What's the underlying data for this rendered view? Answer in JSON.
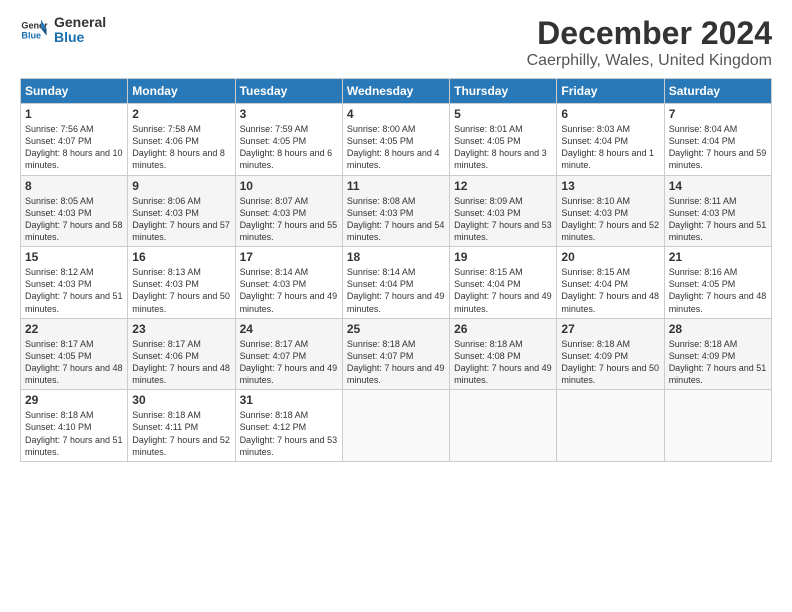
{
  "logo": {
    "line1": "General",
    "line2": "Blue"
  },
  "title": "December 2024",
  "subtitle": "Caerphilly, Wales, United Kingdom",
  "days_header": [
    "Sunday",
    "Monday",
    "Tuesday",
    "Wednesday",
    "Thursday",
    "Friday",
    "Saturday"
  ],
  "weeks": [
    [
      {
        "num": "1",
        "sunrise": "Sunrise: 7:56 AM",
        "sunset": "Sunset: 4:07 PM",
        "daylight": "Daylight: 8 hours and 10 minutes."
      },
      {
        "num": "2",
        "sunrise": "Sunrise: 7:58 AM",
        "sunset": "Sunset: 4:06 PM",
        "daylight": "Daylight: 8 hours and 8 minutes."
      },
      {
        "num": "3",
        "sunrise": "Sunrise: 7:59 AM",
        "sunset": "Sunset: 4:05 PM",
        "daylight": "Daylight: 8 hours and 6 minutes."
      },
      {
        "num": "4",
        "sunrise": "Sunrise: 8:00 AM",
        "sunset": "Sunset: 4:05 PM",
        "daylight": "Daylight: 8 hours and 4 minutes."
      },
      {
        "num": "5",
        "sunrise": "Sunrise: 8:01 AM",
        "sunset": "Sunset: 4:05 PM",
        "daylight": "Daylight: 8 hours and 3 minutes."
      },
      {
        "num": "6",
        "sunrise": "Sunrise: 8:03 AM",
        "sunset": "Sunset: 4:04 PM",
        "daylight": "Daylight: 8 hours and 1 minute."
      },
      {
        "num": "7",
        "sunrise": "Sunrise: 8:04 AM",
        "sunset": "Sunset: 4:04 PM",
        "daylight": "Daylight: 7 hours and 59 minutes."
      }
    ],
    [
      {
        "num": "8",
        "sunrise": "Sunrise: 8:05 AM",
        "sunset": "Sunset: 4:03 PM",
        "daylight": "Daylight: 7 hours and 58 minutes."
      },
      {
        "num": "9",
        "sunrise": "Sunrise: 8:06 AM",
        "sunset": "Sunset: 4:03 PM",
        "daylight": "Daylight: 7 hours and 57 minutes."
      },
      {
        "num": "10",
        "sunrise": "Sunrise: 8:07 AM",
        "sunset": "Sunset: 4:03 PM",
        "daylight": "Daylight: 7 hours and 55 minutes."
      },
      {
        "num": "11",
        "sunrise": "Sunrise: 8:08 AM",
        "sunset": "Sunset: 4:03 PM",
        "daylight": "Daylight: 7 hours and 54 minutes."
      },
      {
        "num": "12",
        "sunrise": "Sunrise: 8:09 AM",
        "sunset": "Sunset: 4:03 PM",
        "daylight": "Daylight: 7 hours and 53 minutes."
      },
      {
        "num": "13",
        "sunrise": "Sunrise: 8:10 AM",
        "sunset": "Sunset: 4:03 PM",
        "daylight": "Daylight: 7 hours and 52 minutes."
      },
      {
        "num": "14",
        "sunrise": "Sunrise: 8:11 AM",
        "sunset": "Sunset: 4:03 PM",
        "daylight": "Daylight: 7 hours and 51 minutes."
      }
    ],
    [
      {
        "num": "15",
        "sunrise": "Sunrise: 8:12 AM",
        "sunset": "Sunset: 4:03 PM",
        "daylight": "Daylight: 7 hours and 51 minutes."
      },
      {
        "num": "16",
        "sunrise": "Sunrise: 8:13 AM",
        "sunset": "Sunset: 4:03 PM",
        "daylight": "Daylight: 7 hours and 50 minutes."
      },
      {
        "num": "17",
        "sunrise": "Sunrise: 8:14 AM",
        "sunset": "Sunset: 4:03 PM",
        "daylight": "Daylight: 7 hours and 49 minutes."
      },
      {
        "num": "18",
        "sunrise": "Sunrise: 8:14 AM",
        "sunset": "Sunset: 4:04 PM",
        "daylight": "Daylight: 7 hours and 49 minutes."
      },
      {
        "num": "19",
        "sunrise": "Sunrise: 8:15 AM",
        "sunset": "Sunset: 4:04 PM",
        "daylight": "Daylight: 7 hours and 49 minutes."
      },
      {
        "num": "20",
        "sunrise": "Sunrise: 8:15 AM",
        "sunset": "Sunset: 4:04 PM",
        "daylight": "Daylight: 7 hours and 48 minutes."
      },
      {
        "num": "21",
        "sunrise": "Sunrise: 8:16 AM",
        "sunset": "Sunset: 4:05 PM",
        "daylight": "Daylight: 7 hours and 48 minutes."
      }
    ],
    [
      {
        "num": "22",
        "sunrise": "Sunrise: 8:17 AM",
        "sunset": "Sunset: 4:05 PM",
        "daylight": "Daylight: 7 hours and 48 minutes."
      },
      {
        "num": "23",
        "sunrise": "Sunrise: 8:17 AM",
        "sunset": "Sunset: 4:06 PM",
        "daylight": "Daylight: 7 hours and 48 minutes."
      },
      {
        "num": "24",
        "sunrise": "Sunrise: 8:17 AM",
        "sunset": "Sunset: 4:07 PM",
        "daylight": "Daylight: 7 hours and 49 minutes."
      },
      {
        "num": "25",
        "sunrise": "Sunrise: 8:18 AM",
        "sunset": "Sunset: 4:07 PM",
        "daylight": "Daylight: 7 hours and 49 minutes."
      },
      {
        "num": "26",
        "sunrise": "Sunrise: 8:18 AM",
        "sunset": "Sunset: 4:08 PM",
        "daylight": "Daylight: 7 hours and 49 minutes."
      },
      {
        "num": "27",
        "sunrise": "Sunrise: 8:18 AM",
        "sunset": "Sunset: 4:09 PM",
        "daylight": "Daylight: 7 hours and 50 minutes."
      },
      {
        "num": "28",
        "sunrise": "Sunrise: 8:18 AM",
        "sunset": "Sunset: 4:09 PM",
        "daylight": "Daylight: 7 hours and 51 minutes."
      }
    ],
    [
      {
        "num": "29",
        "sunrise": "Sunrise: 8:18 AM",
        "sunset": "Sunset: 4:10 PM",
        "daylight": "Daylight: 7 hours and 51 minutes."
      },
      {
        "num": "30",
        "sunrise": "Sunrise: 8:18 AM",
        "sunset": "Sunset: 4:11 PM",
        "daylight": "Daylight: 7 hours and 52 minutes."
      },
      {
        "num": "31",
        "sunrise": "Sunrise: 8:18 AM",
        "sunset": "Sunset: 4:12 PM",
        "daylight": "Daylight: 7 hours and 53 minutes."
      },
      null,
      null,
      null,
      null
    ]
  ]
}
